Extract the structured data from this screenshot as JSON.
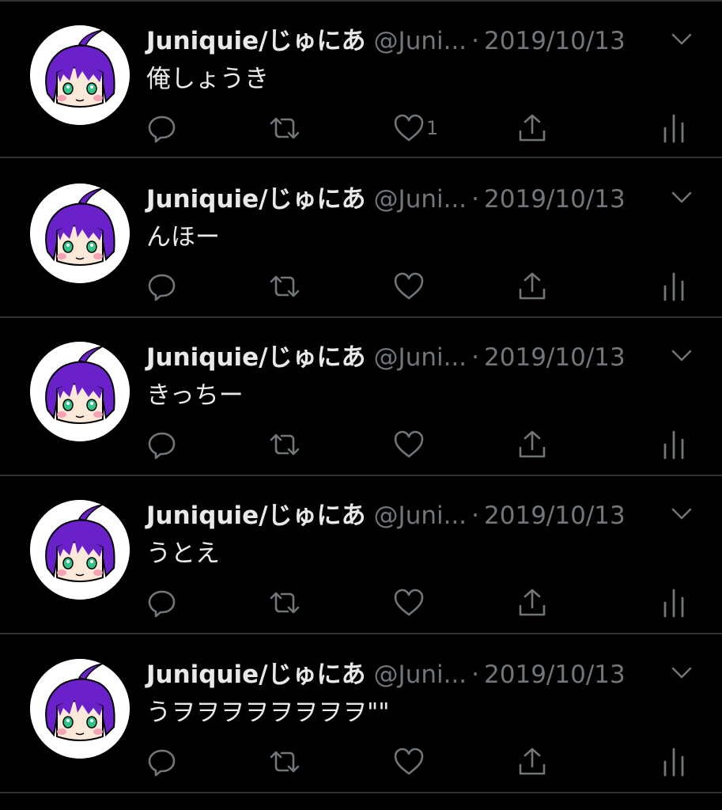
{
  "colors": {
    "background": "#000000",
    "divider": "#2f3336",
    "primary_text": "#e7e9ea",
    "secondary_text": "#71767b",
    "avatar_hair": "#6a21c9",
    "avatar_eyes": "#2ec48a"
  },
  "tweets": [
    {
      "display_name": "Juniquie/じゅにあ",
      "handle": "@Juni...",
      "separator": "·",
      "date": "2019/10/13",
      "text": "俺しょうき",
      "like_count": "1"
    },
    {
      "display_name": "Juniquie/じゅにあ",
      "handle": "@Juni...",
      "separator": "·",
      "date": "2019/10/13",
      "text": "んほー",
      "like_count": ""
    },
    {
      "display_name": "Juniquie/じゅにあ",
      "handle": "@Juni...",
      "separator": "·",
      "date": "2019/10/13",
      "text": "きっちー",
      "like_count": ""
    },
    {
      "display_name": "Juniquie/じゅにあ",
      "handle": "@Juni...",
      "separator": "·",
      "date": "2019/10/13",
      "text": "うとえ",
      "like_count": ""
    },
    {
      "display_name": "Juniquie/じゅにあ",
      "handle": "@Juni...",
      "separator": "·",
      "date": "2019/10/13",
      "text": "うヲヲヲヲヲヲヲヲ\"\"",
      "like_count": ""
    }
  ],
  "icons": {
    "reply": "reply-icon",
    "retweet": "retweet-icon",
    "like": "heart-icon",
    "share": "share-icon",
    "analytics": "analytics-icon",
    "more": "chevron-down-icon"
  }
}
